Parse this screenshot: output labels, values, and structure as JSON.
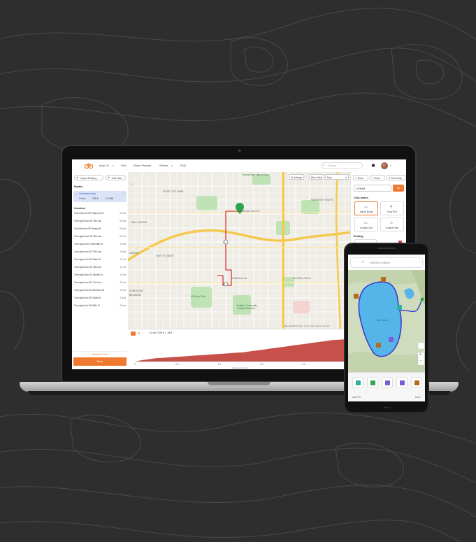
{
  "colors": {
    "accent": "#ef7a2f",
    "route": "#d33c3c",
    "lake": "#55b5e8",
    "phone_route": "#3b3ccf"
  },
  "nav": {
    "items": [
      "Jump To",
      "Find",
      "Route Planner",
      "Stories",
      "FAQ"
    ],
    "search_placeholder": "Search"
  },
  "left_panel": {
    "import_label": "Import Existing",
    "add_new_label": "Add New",
    "routes_heading": "Routes",
    "route": {
      "name": "Untracked route",
      "distance": "2.5 mi",
      "elevation": "235 ft",
      "time": "0:13:48"
    },
    "cuesheet_heading": "Cuesheet",
    "cues": [
      {
        "text": "Turn left onto NE Tillamook St",
        "dist": "0.0 mi"
      },
      {
        "text": "Turn right onto NE 74th Ave",
        "dist": "0.0 mi"
      },
      {
        "text": "Turn left onto NE Halsey St",
        "dist": "0.5 mi"
      },
      {
        "text": "Turn right onto NE 74th Ave",
        "dist": "0.6 mi"
      },
      {
        "text": "Turn right onto E Burnside St",
        "dist": "1.2 mi"
      },
      {
        "text": "Turn right onto SE 79th Ave",
        "dist": "1.4 mi"
      },
      {
        "text": "Turn right onto SE Stark St",
        "dist": "1.7 mi"
      },
      {
        "text": "Turn right onto SE 76th Ave",
        "dist": "1.7 mi"
      },
      {
        "text": "Turn right onto SE Yamhill St",
        "dist": "1.9 mi"
      },
      {
        "text": "Turn right onto SE 71st Ave",
        "dist": "2.0 mi"
      },
      {
        "text": "Turn right onto SE Morrison St",
        "dist": "2.2 mi"
      },
      {
        "text": "Turn right onto SE Scott Dr",
        "dist": "2.3 mi"
      },
      {
        "text": "Turn right onto SE 66th Pl",
        "dist": "2.5 mi"
      }
    ],
    "review_label": "Review Cues",
    "save_label": "Save"
  },
  "map": {
    "settings_label": "Settings",
    "bike_paths_label": "Bike Paths",
    "map_type_label": "Map",
    "labels": {
      "rose_city_park": "ROSE CITY PARK",
      "hollywood": "HOLLYWOOD",
      "madison_south": "MADISON SOUTH",
      "parkrose": "PARKROSE HEIGHTS",
      "north_tabor": "NORTH TABOR",
      "montavilla": "MONTAVILLA",
      "russellville": "RUSSELLVILLE",
      "belmont": "BELMONT",
      "mt_tabor": "Mt Tabor Park",
      "rocky_butte": "Rocky Butte Natural Area",
      "portland_cc": "Portland Community College Southeast",
      "kellogg": "Kellogg",
      "sunnyside": "SUNNYSIDE",
      "elmont": "ELMONT",
      "market": "MARKET"
    },
    "markers": [
      "1",
      "2"
    ],
    "footer": "Map data ©2024 Google · Terms of Use · Report a map error"
  },
  "elevation": {
    "summary": "2.5 mi +235 ft / -18 ft",
    "x_ticks": [
      "0",
      "0.5",
      "1.0",
      "1.5",
      "2.0",
      "2.5"
    ],
    "xlabel": "distance in miles",
    "profile": [
      0,
      3,
      5,
      7,
      8,
      9,
      10,
      11,
      12,
      13,
      14,
      15,
      16,
      17,
      18,
      19,
      20,
      22,
      24,
      26,
      28,
      30,
      32,
      34,
      36,
      38,
      40,
      42,
      44,
      46,
      47,
      48
    ]
  },
  "right_panel": {
    "undo_label": "Undo",
    "redo_label": "Redo",
    "clear_label": "Clear Map",
    "input_value": "97266M",
    "go_label": "Go",
    "click_action_heading": "Click Action",
    "actions": [
      "Add to Route",
      "Drop POI",
      "Custom Cue",
      "Control Point"
    ],
    "routing_heading": "Routing"
  },
  "phone": {
    "search_placeholder": "Search location",
    "lake_label": "Lake Tahoe",
    "add_poi_label": "Add POI",
    "done_label": "Done",
    "poi_colors": [
      "#2fb3a0",
      "#34a853",
      "#7b5cd6",
      "#7b5cd6",
      "#b86b1d"
    ]
  }
}
